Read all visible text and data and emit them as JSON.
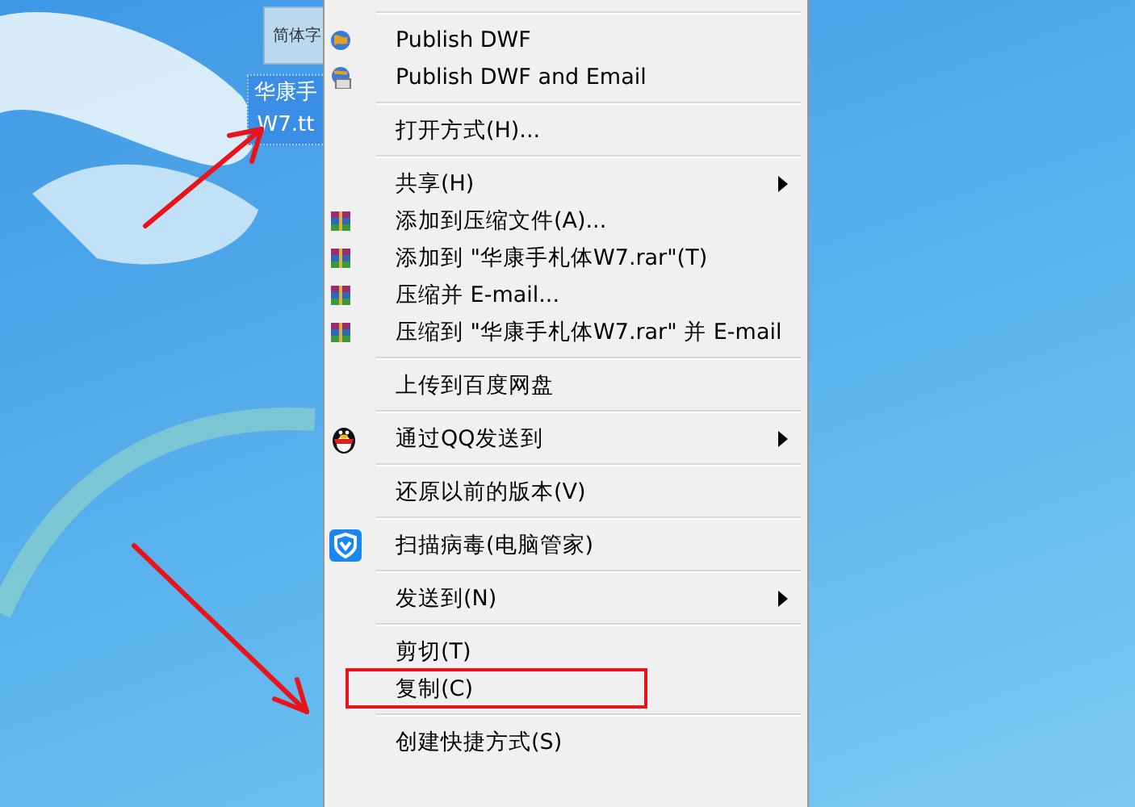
{
  "desktop_icon": {
    "icon_text": "简体字",
    "label_lines": [
      "华康手",
      "W7.tt"
    ],
    "selected": true
  },
  "context_menu": {
    "items": [
      {
        "kind": "separator"
      },
      {
        "kind": "globe",
        "label": "Publish DWF",
        "submenu": false,
        "highlighted": false
      },
      {
        "kind": "globe-mail",
        "label": "Publish DWF and Email",
        "submenu": false,
        "highlighted": false
      },
      {
        "kind": "separator"
      },
      {
        "kind": "plain",
        "label": "打开方式(H)...",
        "submenu": false,
        "highlighted": false
      },
      {
        "kind": "separator"
      },
      {
        "kind": "plain",
        "label": "共享(H)",
        "submenu": true,
        "highlighted": false
      },
      {
        "kind": "archive",
        "label": "添加到压缩文件(A)...",
        "submenu": false,
        "highlighted": false
      },
      {
        "kind": "archive",
        "label": "添加到 \"华康手札体W7.rar\"(T)",
        "submenu": false,
        "highlighted": false
      },
      {
        "kind": "archive",
        "label": "压缩并 E-mail...",
        "submenu": false,
        "highlighted": false
      },
      {
        "kind": "archive",
        "label": "压缩到 \"华康手札体W7.rar\" 并 E-mail",
        "submenu": false,
        "highlighted": false
      },
      {
        "kind": "separator"
      },
      {
        "kind": "plain",
        "label": "上传到百度网盘",
        "submenu": false,
        "highlighted": false
      },
      {
        "kind": "separator"
      },
      {
        "kind": "penguin",
        "label": "通过QQ发送到",
        "submenu": true,
        "highlighted": false
      },
      {
        "kind": "separator"
      },
      {
        "kind": "plain",
        "label": "还原以前的版本(V)",
        "submenu": false,
        "highlighted": false
      },
      {
        "kind": "separator"
      },
      {
        "kind": "shield",
        "label": "扫描病毒(电脑管家)",
        "submenu": false,
        "highlighted": false
      },
      {
        "kind": "separator"
      },
      {
        "kind": "plain",
        "label": "发送到(N)",
        "submenu": true,
        "highlighted": false
      },
      {
        "kind": "separator"
      },
      {
        "kind": "plain",
        "label": "剪切(T)",
        "submenu": false,
        "highlighted": false
      },
      {
        "kind": "plain",
        "label": "复制(C)",
        "submenu": false,
        "highlighted": true
      },
      {
        "kind": "separator"
      },
      {
        "kind": "plain",
        "label": "创建快捷方式(S)",
        "submenu": false,
        "highlighted": false
      }
    ]
  }
}
